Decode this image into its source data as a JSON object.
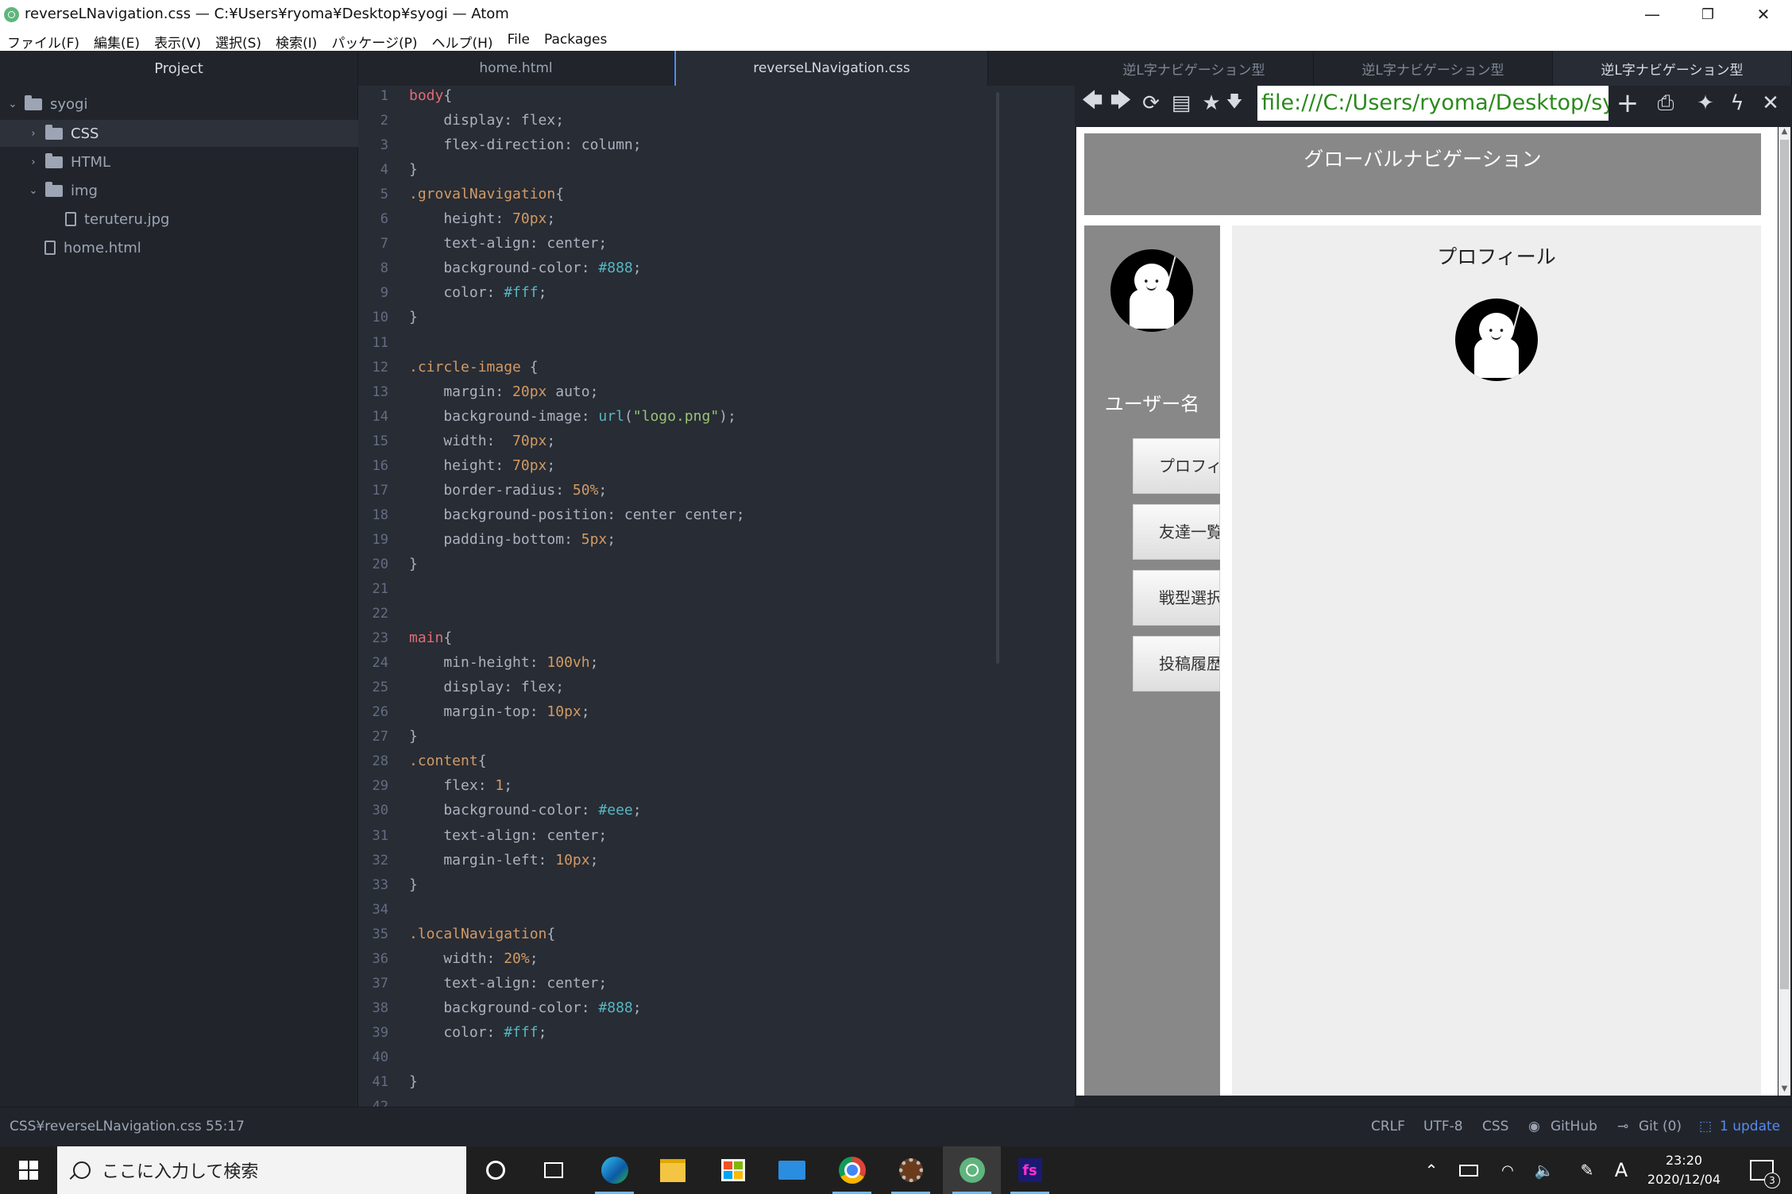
{
  "window": {
    "title": "reverseLNavigation.css — C:¥Users¥ryoma¥Desktop¥syogi — Atom",
    "controls": {
      "minimize": "—",
      "restore": "❐",
      "close": "✕"
    }
  },
  "menu": [
    "ファイル(F)",
    "編集(E)",
    "表示(V)",
    "選択(S)",
    "検索(I)",
    "パッケージ(P)",
    "ヘルプ(H)",
    "File",
    "Packages"
  ],
  "tree": {
    "header": "Project",
    "root": "syogi",
    "items": [
      {
        "label": "CSS",
        "type": "folder",
        "expanded": false,
        "selected": true
      },
      {
        "label": "HTML",
        "type": "folder",
        "expanded": false,
        "selected": false
      },
      {
        "label": "img",
        "type": "folder",
        "expanded": true,
        "selected": false
      },
      {
        "label": "teruteru.jpg",
        "type": "image",
        "selected": false
      },
      {
        "label": "home.html",
        "type": "file",
        "selected": false
      }
    ]
  },
  "editor": {
    "tabs": [
      {
        "label": "home.html",
        "active": false
      },
      {
        "label": "reverseLNavigation.css",
        "active": true
      }
    ],
    "lines": [
      [
        "1",
        [
          [
            "sel-c",
            "body"
          ],
          [
            "",
            "{"
          ]
        ]
      ],
      [
        "2",
        [
          [
            "",
            "    display: flex;"
          ]
        ]
      ],
      [
        "3",
        [
          [
            "",
            "    flex-direction: column;"
          ]
        ]
      ],
      [
        "4",
        [
          [
            "",
            "}"
          ]
        ]
      ],
      [
        "5",
        [
          [
            "sel-cls",
            ".grovalNavigation"
          ],
          [
            "",
            "{"
          ]
        ]
      ],
      [
        "6",
        [
          [
            "",
            "    height: "
          ],
          [
            "num",
            "70px"
          ],
          [
            "",
            ";"
          ]
        ]
      ],
      [
        "7",
        [
          [
            "",
            "    text-align: center;"
          ]
        ]
      ],
      [
        "8",
        [
          [
            "",
            "    background-color: "
          ],
          [
            "hex",
            "#888"
          ],
          [
            "",
            ";"
          ]
        ]
      ],
      [
        "9",
        [
          [
            "",
            "    color: "
          ],
          [
            "hex",
            "#fff"
          ],
          [
            "",
            ";"
          ]
        ]
      ],
      [
        "10",
        [
          [
            "",
            "}"
          ]
        ]
      ],
      [
        "11",
        []
      ],
      [
        "12",
        [
          [
            "sel-cls",
            ".circle-image"
          ],
          [
            "",
            " {"
          ]
        ]
      ],
      [
        "13",
        [
          [
            "",
            "    margin: "
          ],
          [
            "num",
            "20px"
          ],
          [
            "",
            " auto;"
          ]
        ]
      ],
      [
        "14",
        [
          [
            "",
            "    background-image: "
          ],
          [
            "fn",
            "url"
          ],
          [
            "",
            "("
          ],
          [
            "str",
            "\"logo.png\""
          ],
          [
            "",
            ");"
          ]
        ]
      ],
      [
        "15",
        [
          [
            "",
            "    width:  "
          ],
          [
            "num",
            "70px"
          ],
          [
            "",
            ";"
          ]
        ]
      ],
      [
        "16",
        [
          [
            "",
            "    height: "
          ],
          [
            "num",
            "70px"
          ],
          [
            "",
            ";"
          ]
        ]
      ],
      [
        "17",
        [
          [
            "",
            "    border-radius: "
          ],
          [
            "num",
            "50%"
          ],
          [
            "",
            ";"
          ]
        ]
      ],
      [
        "18",
        [
          [
            "",
            "    background-position: center center;"
          ]
        ]
      ],
      [
        "19",
        [
          [
            "",
            "    padding-bottom: "
          ],
          [
            "num",
            "5px"
          ],
          [
            "",
            ";"
          ]
        ]
      ],
      [
        "20",
        [
          [
            "",
            "}"
          ]
        ]
      ],
      [
        "21",
        []
      ],
      [
        "22",
        []
      ],
      [
        "23",
        [
          [
            "sel-c",
            "main"
          ],
          [
            "",
            "{"
          ]
        ]
      ],
      [
        "24",
        [
          [
            "",
            "    min-height: "
          ],
          [
            "num",
            "100vh"
          ],
          [
            "",
            ";"
          ]
        ]
      ],
      [
        "25",
        [
          [
            "",
            "    display: flex;"
          ]
        ]
      ],
      [
        "26",
        [
          [
            "",
            "    margin-top: "
          ],
          [
            "num",
            "10px"
          ],
          [
            "",
            ";"
          ]
        ]
      ],
      [
        "27",
        [
          [
            "",
            "}"
          ]
        ]
      ],
      [
        "28",
        [
          [
            "sel-cls",
            ".content"
          ],
          [
            "",
            "{"
          ]
        ]
      ],
      [
        "29",
        [
          [
            "",
            "    flex: "
          ],
          [
            "num",
            "1"
          ],
          [
            "",
            ";"
          ]
        ]
      ],
      [
        "30",
        [
          [
            "",
            "    background-color: "
          ],
          [
            "hex",
            "#eee"
          ],
          [
            "",
            ";"
          ]
        ]
      ],
      [
        "31",
        [
          [
            "",
            "    text-align: center;"
          ]
        ]
      ],
      [
        "32",
        [
          [
            "",
            "    margin-left: "
          ],
          [
            "num",
            "10px"
          ],
          [
            "",
            ";"
          ]
        ]
      ],
      [
        "33",
        [
          [
            "",
            "}"
          ]
        ]
      ],
      [
        "34",
        []
      ],
      [
        "35",
        [
          [
            "sel-cls",
            ".localNavigation"
          ],
          [
            "",
            "{"
          ]
        ]
      ],
      [
        "36",
        [
          [
            "",
            "    width: "
          ],
          [
            "num",
            "20%"
          ],
          [
            "",
            ";"
          ]
        ]
      ],
      [
        "37",
        [
          [
            "",
            "    text-align: center;"
          ]
        ]
      ],
      [
        "38",
        [
          [
            "",
            "    background-color: "
          ],
          [
            "hex",
            "#888"
          ],
          [
            "",
            ";"
          ]
        ]
      ],
      [
        "39",
        [
          [
            "",
            "    color: "
          ],
          [
            "hex",
            "#fff"
          ],
          [
            "",
            ";"
          ]
        ]
      ],
      [
        "40",
        []
      ],
      [
        "41",
        [
          [
            "",
            "}"
          ]
        ]
      ],
      [
        "42",
        []
      ]
    ]
  },
  "preview": {
    "tabs": [
      {
        "label": "逆L字ナビゲーション型",
        "active": false
      },
      {
        "label": "逆L字ナビゲーション型",
        "active": false
      },
      {
        "label": "逆L字ナビゲーション型",
        "active": true
      }
    ],
    "url": "file:///C:/Users/ryoma/Desktop/syogi/HTML/home.html",
    "page": {
      "global_nav": "グローバルナビゲーション",
      "username": "ユーザー名",
      "nav_buttons": [
        "プロフィール",
        "友達一覧",
        "戦型選択",
        "投稿履歴"
      ],
      "content_title": "プロフィール"
    }
  },
  "status": {
    "path": "CSS¥reverseLNavigation.css",
    "cursor": "55:17",
    "line_ending": "CRLF",
    "encoding": "UTF-8",
    "grammar": "CSS",
    "github": "GitHub",
    "git": "Git (0)",
    "update": "1 update"
  },
  "taskbar": {
    "search_placeholder": "ここに入力して検索",
    "time": "23:20",
    "date": "2020/12/04",
    "ime": "A",
    "notifications": "3"
  },
  "colors": {
    "accent": "#568af2",
    "tree_bg": "#21252b",
    "editor_bg": "#282c34",
    "nav_gray": "#888888",
    "content_bg": "#eeeeee",
    "url_text": "#2a8a1c"
  }
}
